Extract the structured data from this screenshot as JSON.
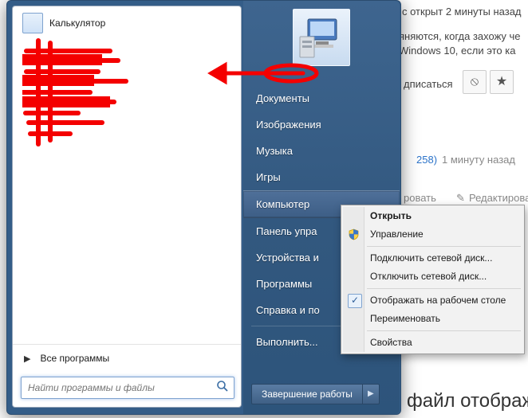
{
  "bg": {
    "l1": "с открыт 2 минуты назад",
    "l2": "яняются, когда захожу че",
    "l3": "Windows 10, если это ка",
    "subscribe": "дписаться",
    "time2": "1 минуту назад",
    "rep": "258)",
    "edit": "Редактировать",
    "act": "ровать",
    "footer": "файл отображается к"
  },
  "start": {
    "calc": "Калькулятор",
    "allprograms": "Все программы",
    "search_placeholder": "Найти программы и файлы"
  },
  "right": {
    "documents": "Документы",
    "pictures": "Изображения",
    "music": "Музыка",
    "games": "Игры",
    "computer": "Компьютер",
    "control": "Панель упра",
    "devices": "Устройства и",
    "defaults": "Программы",
    "help": "Справка и по",
    "run": "Выполнить...",
    "shutdown": "Завершение работы"
  },
  "ctx": {
    "open": "Открыть",
    "manage": "Управление",
    "map": "Подключить сетевой диск...",
    "unmap": "Отключить сетевой диск...",
    "show_desktop": "Отображать на рабочем столе",
    "rename": "Переименовать",
    "properties": "Свойства"
  }
}
